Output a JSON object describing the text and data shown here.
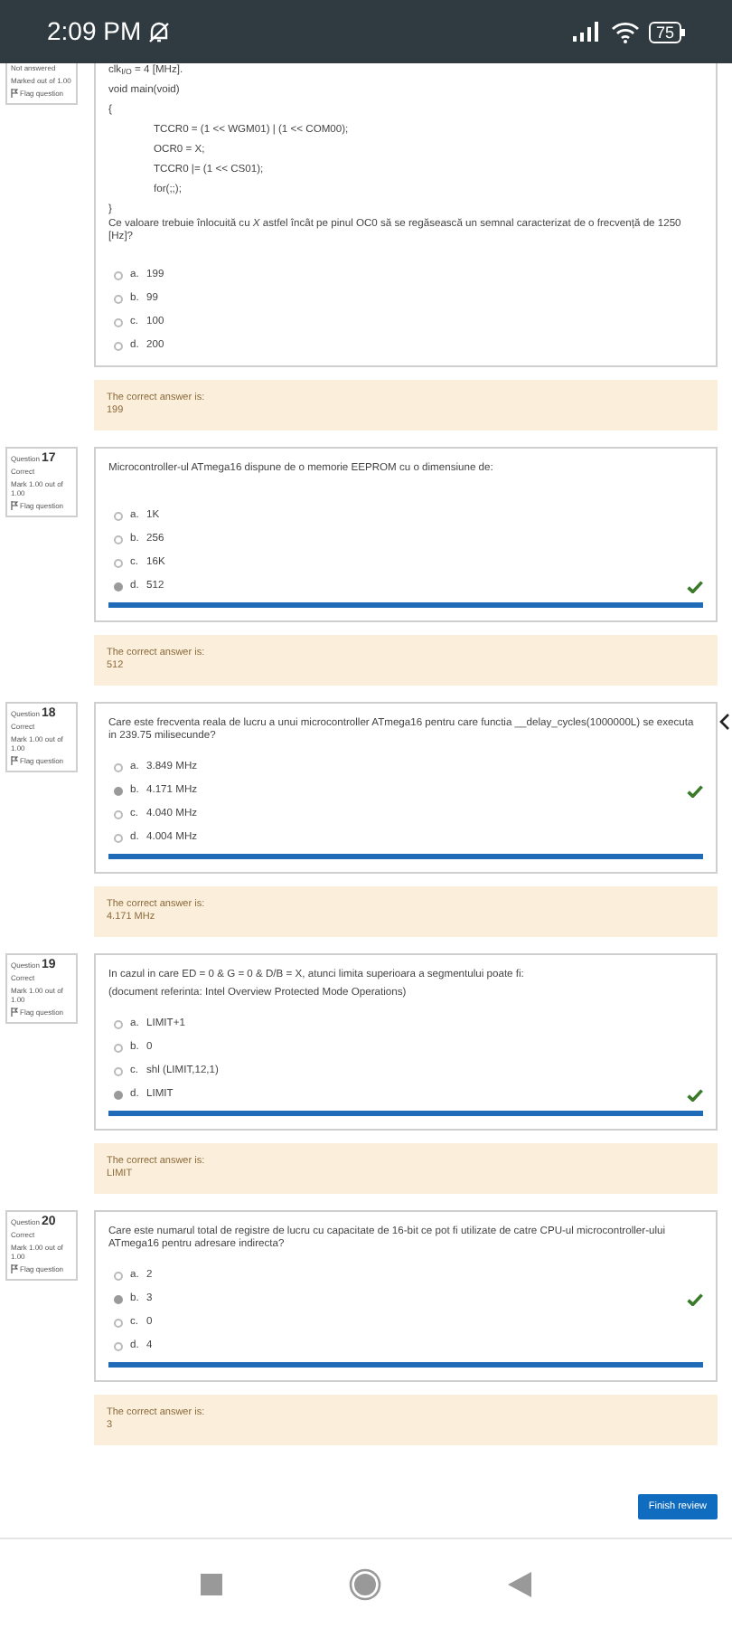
{
  "status_bar": {
    "time": "2:09 PM",
    "battery": "75"
  },
  "questions": [
    {
      "state": "Not answered",
      "mark": "Marked out of 1.00",
      "flag": "Flag question",
      "highlighted": false,
      "code": [
        {
          "text": "clk$_{I/O}$ = 4 [MHz].",
          "indented": false
        },
        {
          "text": "void main(void)",
          "indented": false
        },
        {
          "text": "{",
          "indented": false
        },
        {
          "text": "TCCR0 = (1 << WGM01) | (1 << COM00);",
          "indented": true
        },
        {
          "text": "OCR0 = X;",
          "indented": true
        },
        {
          "text": "TCCR0 |= (1 << CS01);",
          "indented": true
        },
        {
          "text": "for(;;);",
          "indented": true
        },
        {
          "text": "}",
          "indented": false
        }
      ],
      "text": [
        "Ce valoare trebuie înlocuită cu *X* astfel încât pe pinul OC0 să se regăsească un semnal caracterizat de o frecvență de 1250 [Hz]?"
      ],
      "options": [
        {
          "letter": "a.",
          "text": "199",
          "selected": false,
          "correct_mark": false
        },
        {
          "letter": "b.",
          "text": "99",
          "selected": false,
          "correct_mark": false
        },
        {
          "letter": "c.",
          "text": "100",
          "selected": false,
          "correct_mark": false
        },
        {
          "letter": "d.",
          "text": "200",
          "selected": false,
          "correct_mark": false
        }
      ],
      "feedback": {
        "label": "The correct answer is:",
        "answer": "199"
      }
    },
    {
      "label": "Question",
      "number": "17",
      "state": "Correct",
      "mark": "Mark 1.00 out of 1.00",
      "flag": "Flag question",
      "highlighted": true,
      "text": [
        "Microcontroller-ul ATmega16 dispune de o memorie EEPROM cu o dimensiune de:"
      ],
      "options": [
        {
          "letter": "a.",
          "text": "1K",
          "selected": false,
          "correct_mark": false
        },
        {
          "letter": "b.",
          "text": "256",
          "selected": false,
          "correct_mark": false
        },
        {
          "letter": "c.",
          "text": "16K",
          "selected": false,
          "correct_mark": false
        },
        {
          "letter": "d.",
          "text": "512",
          "selected": true,
          "correct_mark": true
        }
      ],
      "feedback": {
        "label": "The correct answer is:",
        "answer": "512"
      }
    },
    {
      "label": "Question",
      "number": "18",
      "state": "Correct",
      "mark": "Mark 1.00 out of 1.00",
      "flag": "Flag question",
      "highlighted": true,
      "text": [
        "Care este frecventa reala de lucru a unui microcontroller ATmega16 pentru care functia __delay_cycles(1000000L) se executa in 239.75 milisecunde?"
      ],
      "options": [
        {
          "letter": "a.",
          "text": "3.849 MHz",
          "selected": false,
          "correct_mark": false
        },
        {
          "letter": "b.",
          "text": "4.171 MHz",
          "selected": true,
          "correct_mark": true
        },
        {
          "letter": "c.",
          "text": "4.040 MHz",
          "selected": false,
          "correct_mark": false
        },
        {
          "letter": "d.",
          "text": "4.004 MHz",
          "selected": false,
          "correct_mark": false
        }
      ],
      "feedback": {
        "label": "The correct answer is:",
        "answer": "4.171 MHz"
      }
    },
    {
      "label": "Question",
      "number": "19",
      "state": "Correct",
      "mark": "Mark 1.00 out of 1.00",
      "flag": "Flag question",
      "highlighted": true,
      "text": [
        "In cazul in care ED = 0  &  G = 0  &  D/B = X, atunci limita superioara a segmentului poate fi:",
        "(document referinta: Intel Overview Protected Mode Operations)"
      ],
      "options": [
        {
          "letter": "a.",
          "text": "LIMIT+1",
          "selected": false,
          "correct_mark": false
        },
        {
          "letter": "b.",
          "text": "0",
          "selected": false,
          "correct_mark": false
        },
        {
          "letter": "c.",
          "text": "shl (LIMIT,12,1)",
          "selected": false,
          "correct_mark": false
        },
        {
          "letter": "d.",
          "text": "LIMIT",
          "selected": true,
          "correct_mark": true
        }
      ],
      "feedback": {
        "label": "The correct answer is:",
        "answer": "LIMIT"
      }
    },
    {
      "label": "Question",
      "number": "20",
      "state": "Correct",
      "mark": "Mark 1.00 out of 1.00",
      "flag": "Flag question",
      "highlighted": true,
      "text": [
        "Care este numarul total de registre de lucru cu capacitate de 16-bit ce pot fi utilizate de catre CPU-ul microcontroller-ului ATmega16 pentru adresare indirecta?"
      ],
      "options": [
        {
          "letter": "a.",
          "text": "2",
          "selected": false,
          "correct_mark": false
        },
        {
          "letter": "b.",
          "text": "3",
          "selected": true,
          "correct_mark": true
        },
        {
          "letter": "c.",
          "text": "0",
          "selected": false,
          "correct_mark": false
        },
        {
          "letter": "d.",
          "text": "4",
          "selected": false,
          "correct_mark": false
        }
      ],
      "feedback": {
        "label": "The correct answer is:",
        "answer": "3"
      }
    }
  ],
  "finish_button": "Finish review"
}
